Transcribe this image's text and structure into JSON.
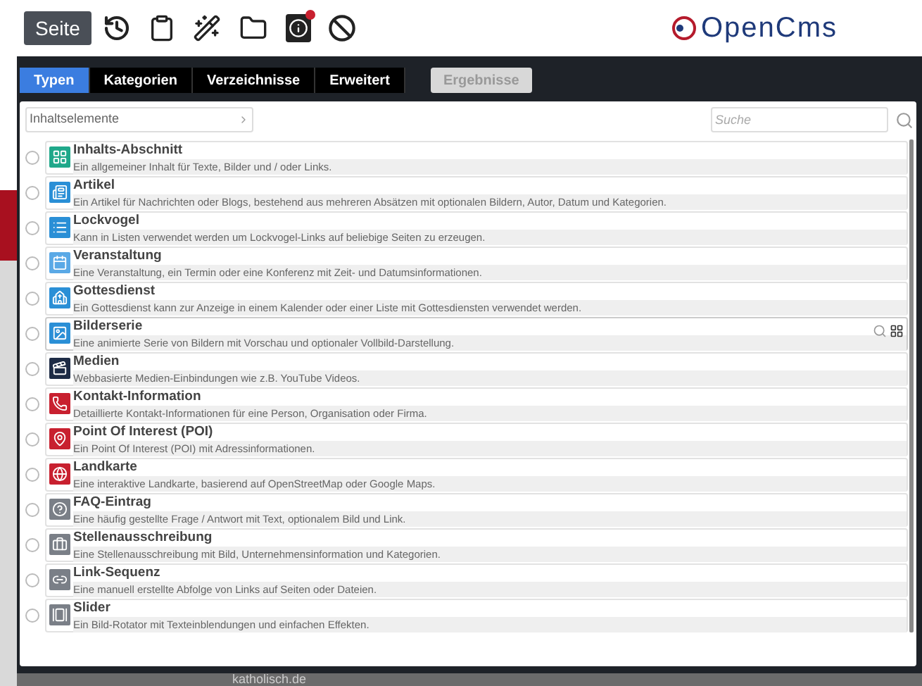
{
  "toolbar": {
    "page_button": "Seite",
    "info_badge": true,
    "logo": "OpenCms"
  },
  "tabs": [
    {
      "label": "Typen",
      "selected": true
    },
    {
      "label": "Kategorien",
      "selected": false
    },
    {
      "label": "Verzeichnisse",
      "selected": false
    },
    {
      "label": "Erweitert",
      "selected": false
    }
  ],
  "results_button": {
    "label": "Ergebnisse",
    "disabled": true
  },
  "filter": {
    "value": "Inhaltselemente"
  },
  "search": {
    "placeholder": "Suche"
  },
  "types": [
    {
      "title": "Inhalts-Abschnitt",
      "description": "Ein allgemeiner Inhalt für Texte, Bilder und / oder Links.",
      "color": "#1fa88a",
      "checked": false,
      "hovered": false
    },
    {
      "title": "Artikel",
      "description": "Ein Artikel für Nachrichten oder Blogs, bestehend aus mehreren Absätzen mit optionalen Bildern, Autor, Datum und Kategorien.",
      "color": "#2a8fd6",
      "checked": false,
      "hovered": false
    },
    {
      "title": "Lockvogel",
      "description": "Kann in Listen verwendet werden um Lockvogel-Links auf beliebige Seiten zu erzeugen.",
      "color": "#2a8fd6",
      "checked": false,
      "hovered": false
    },
    {
      "title": "Veranstaltung",
      "description": "Eine Veranstaltung, ein Termin oder eine Konferenz mit Zeit- und Datumsinformationen.",
      "color": "#5aa9e6",
      "checked": false,
      "hovered": false
    },
    {
      "title": "Gottesdienst",
      "description": "Ein Gottesdienst kann zur Anzeige in einem Kalender oder einer Liste mit Gottesdiensten verwendet werden.",
      "color": "#2a8fd6",
      "checked": false,
      "hovered": false
    },
    {
      "title": "Bilderserie",
      "description": "Eine animierte Serie von Bildern mit Vorschau und optionaler Vollbild-Darstellung.",
      "color": "#2a8fd6",
      "checked": false,
      "hovered": true
    },
    {
      "title": "Medien",
      "description": "Webbasierte Medien-Einbindungen wie z.B. YouTube Videos.",
      "color": "#1d2b45",
      "checked": false,
      "hovered": false
    },
    {
      "title": "Kontakt-Information",
      "description": "Detaillierte Kontakt-Informationen für eine Person, Organisation oder Firma.",
      "color": "#c8202f",
      "checked": false,
      "hovered": false
    },
    {
      "title": "Point Of Interest (POI)",
      "description": "Ein Point Of Interest (POI) mit Adressinformationen.",
      "color": "#c8202f",
      "checked": false,
      "hovered": false
    },
    {
      "title": "Landkarte",
      "description": "Eine interaktive Landkarte, basierend auf OpenStreetMap oder Google Maps.",
      "color": "#c8202f",
      "checked": false,
      "hovered": false
    },
    {
      "title": "FAQ-Eintrag",
      "description": "Eine häufig gestellte Frage / Antwort mit Text, optionalem Bild und Link.",
      "color": "#7a7f87",
      "checked": false,
      "hovered": false
    },
    {
      "title": "Stellenausschreibung",
      "description": "Eine Stellenausschreibung mit Bild, Unternehmensinformation und Kategorien.",
      "color": "#7a7f87",
      "checked": false,
      "hovered": false
    },
    {
      "title": "Link-Sequenz",
      "description": "Eine manuell erstellte Abfolge von Links auf Seiten oder Dateien.",
      "color": "#7a7f87",
      "checked": false,
      "hovered": false
    },
    {
      "title": "Slider",
      "description": "Ein Bild-Rotator mit Texteinblendungen und einfachen Effekten.",
      "color": "#7a7f87",
      "checked": false,
      "hovered": false
    }
  ],
  "background_page": {
    "footer_text": "katholisch.de"
  }
}
